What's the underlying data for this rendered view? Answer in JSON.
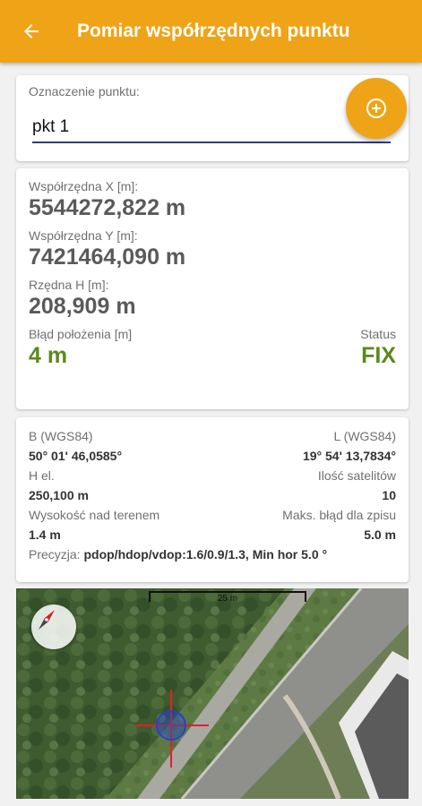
{
  "appbar": {
    "title": "Pomiar współrzędnych punktu",
    "back_icon": "arrow-back-icon",
    "color": "#eea416"
  },
  "point": {
    "label": "Oznaczenie punktu:",
    "value": "pkt 1"
  },
  "fab": {
    "icon": "add-circle-icon"
  },
  "coords": {
    "x_label": "Współrzędna X [m]:",
    "x_value": "5544272,822 m",
    "y_label": "Współrzędna Y [m]:",
    "y_value": "7421464,090 m",
    "h_label": "Rzędna H [m]:",
    "h_value": "208,909 m",
    "err_label": "Błąd położenia [m]",
    "err_value": "4 m",
    "status_label": "Status",
    "status_value": "FIX",
    "status_color": "#5a8a1a"
  },
  "wgs": {
    "b_label": "B  (WGS84)",
    "l_label": "L (WGS84)",
    "b_value": "50° 01' 46,0585°",
    "l_value": "19° 54' 13,7834°",
    "hel_label": "H el.",
    "sat_label": "Ilość satelitów",
    "hel_value": "250,100 m",
    "sat_value": "10",
    "terrain_label": "Wysokość nad terenem",
    "maxerr_label": "Maks. błąd dla zpisu",
    "terrain_value": "1.4 m",
    "maxerr_value": "5.0 m",
    "prec_label": "Precyzja:",
    "prec_value": "pdop/hdop/vdop:1.6/0.9/1.3, Min hor 5.0 °"
  },
  "map": {
    "scale_label": "25 m",
    "compass_icon": "compass-icon",
    "marker_icon": "location-crosshair-icon"
  }
}
